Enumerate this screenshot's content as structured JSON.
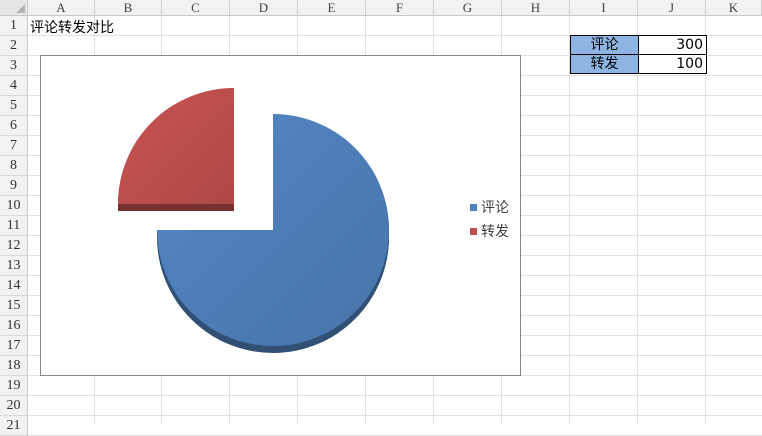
{
  "sheet": {
    "columns": [
      "A",
      "B",
      "C",
      "D",
      "E",
      "F",
      "G",
      "H",
      "I",
      "J",
      "K"
    ],
    "rows": [
      "1",
      "2",
      "3",
      "4",
      "5",
      "6",
      "7",
      "8",
      "9",
      "10",
      "11",
      "12",
      "13",
      "14",
      "15",
      "16",
      "17",
      "18",
      "19",
      "20",
      "21"
    ],
    "a1_title": "评论转发对比"
  },
  "table": [
    {
      "label": "评论",
      "value": "300"
    },
    {
      "label": "转发",
      "value": "100"
    }
  ],
  "chart_data": {
    "type": "pie",
    "title": "",
    "style": "3d-exploded",
    "categories": [
      "评论",
      "转发"
    ],
    "values": [
      300,
      100
    ],
    "colors": [
      "#4f81bd",
      "#c0504d"
    ],
    "legend": "right"
  }
}
